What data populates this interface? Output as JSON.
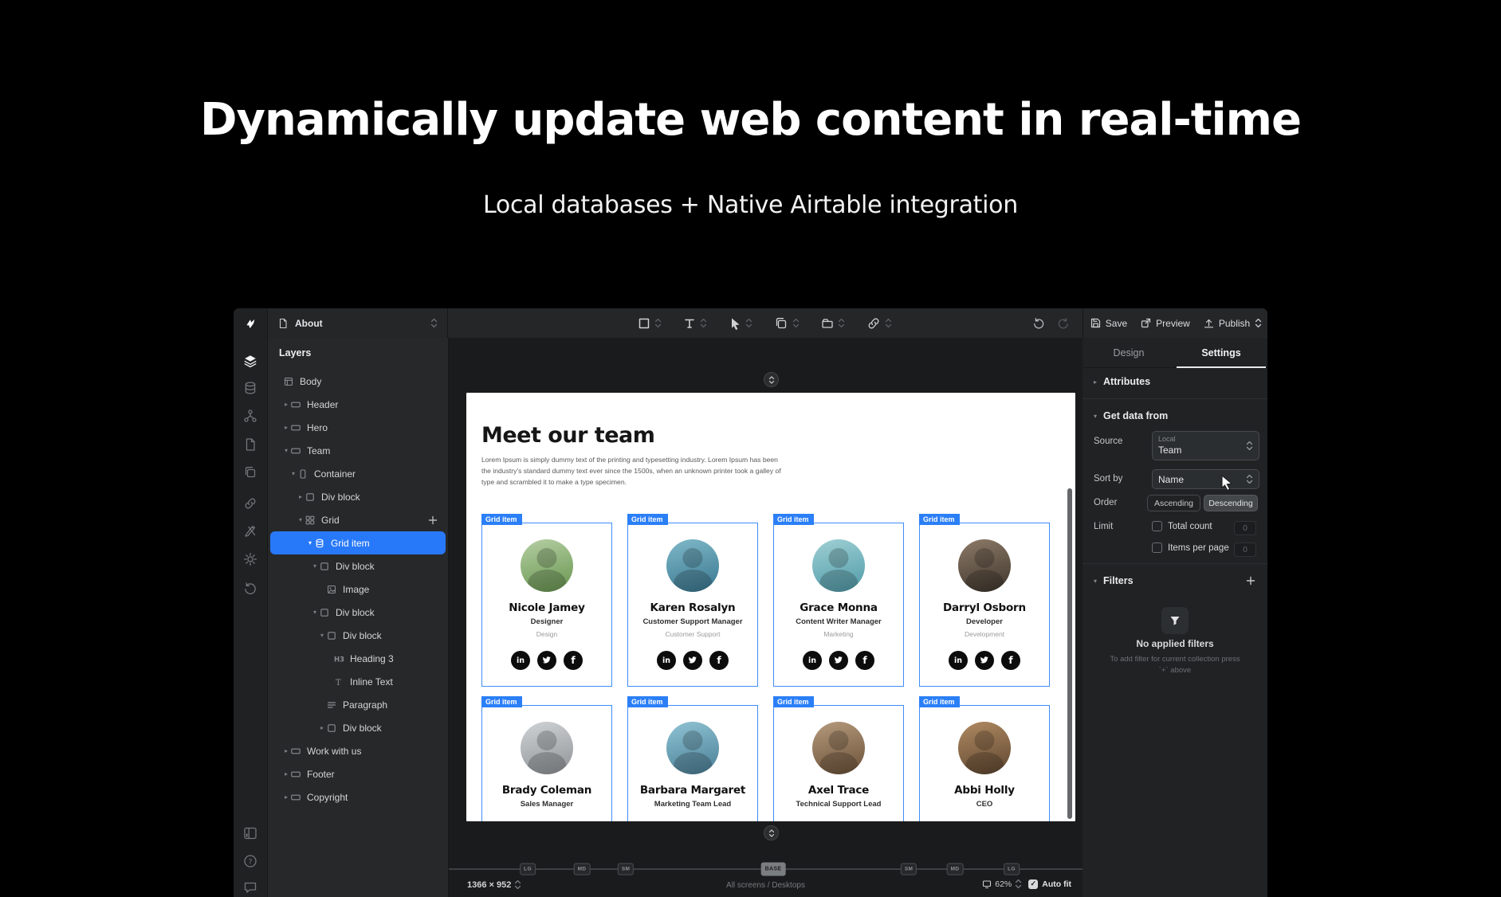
{
  "hero": {
    "title": "Dynamically update web content in real-time",
    "subtitle": "Local databases + Native Airtable integration"
  },
  "app": {
    "topbar": {
      "page_switcher": {
        "icon": "page-icon",
        "label": "About"
      },
      "tools": [
        "rect-tool-icon",
        "text-tool-icon",
        "cursor-tool-icon",
        "copy-tool-icon",
        "folder-tool-icon",
        "link-tool-icon"
      ],
      "history": {
        "undo": "undo-icon",
        "redo": "redo-icon"
      },
      "actions": {
        "save": "Save",
        "preview": "Preview",
        "publish": "Publish"
      }
    },
    "rail": {
      "top": [
        "layers",
        "database",
        "flow",
        "page",
        "copy",
        "link",
        "tools",
        "gear",
        "history"
      ],
      "bottom": [
        "panels",
        "help",
        "chat"
      ]
    },
    "layers_panel": {
      "title": "Layers",
      "tree": [
        {
          "label": "Body",
          "icon": "body",
          "level": 0,
          "caret": "none"
        },
        {
          "label": "Header",
          "icon": "section",
          "level": 1,
          "caret": "closed"
        },
        {
          "label": "Hero",
          "icon": "section",
          "level": 1,
          "caret": "closed"
        },
        {
          "label": "Team",
          "icon": "section",
          "level": 1,
          "caret": "open"
        },
        {
          "label": "Container",
          "icon": "container",
          "level": 2,
          "caret": "open"
        },
        {
          "label": "Div block",
          "icon": "div",
          "level": 3,
          "caret": "closed"
        },
        {
          "label": "Grid",
          "icon": "grid",
          "level": 3,
          "caret": "open",
          "add": true
        },
        {
          "label": "Grid item",
          "icon": "database",
          "level": 4,
          "caret": "open",
          "selected": true
        },
        {
          "label": "Div block",
          "icon": "div",
          "level": 5,
          "caret": "open"
        },
        {
          "label": "Image",
          "icon": "image",
          "level": 6,
          "caret": "none"
        },
        {
          "label": "Div block",
          "icon": "div",
          "level": 5,
          "caret": "open"
        },
        {
          "label": "Div block",
          "icon": "div",
          "level": 6,
          "caret": "open"
        },
        {
          "label": "Heading 3",
          "icon": "h3",
          "level": 7,
          "caret": "none"
        },
        {
          "label": "Inline Text",
          "icon": "text",
          "level": 7,
          "caret": "none"
        },
        {
          "label": "Paragraph",
          "icon": "paragraph",
          "level": 6,
          "caret": "none"
        },
        {
          "label": "Div block",
          "icon": "div",
          "level": 6,
          "caret": "closed"
        },
        {
          "label": "Work with us",
          "icon": "section",
          "level": 1,
          "caret": "closed"
        },
        {
          "label": "Footer",
          "icon": "section",
          "level": 1,
          "caret": "closed"
        },
        {
          "label": "Copyright",
          "icon": "section",
          "level": 1,
          "caret": "closed"
        }
      ]
    },
    "canvas": {
      "page": {
        "heading": "Meet our team",
        "paragraph": "Lorem Ipsum is simply dummy text of the printing and typesetting industry. Lorem Ipsum has been the industry's standard dummy text ever since the 1500s, when an unknown printer took a galley of type and scrambled it to make a type specimen.",
        "grid_tag": "Grid item",
        "socials": [
          "linkedin",
          "twitter",
          "facebook"
        ],
        "cards": [
          {
            "name": "Nicole Jamey",
            "role": "Designer",
            "dept": "Design",
            "avatar": [
              "#b5cfa3",
              "#67954f"
            ]
          },
          {
            "name": "Karen Rosalyn",
            "role": "Customer Support Manager",
            "dept": "Customer Support",
            "avatar": [
              "#7fb9c9",
              "#39768f"
            ]
          },
          {
            "name": "Grace Monna",
            "role": "Content Writer Manager",
            "dept": "Marketing",
            "avatar": [
              "#9fd0d4",
              "#4f9aa8"
            ]
          },
          {
            "name": "Darryl Osborn",
            "role": "Developer",
            "dept": "Development",
            "avatar": [
              "#8d7a68",
              "#3e352c"
            ]
          },
          {
            "name": "Brady Coleman",
            "role": "Sales Manager",
            "dept": "",
            "avatar": [
              "#cfd3d6",
              "#8f9397"
            ]
          },
          {
            "name": "Barbara Margaret",
            "role": "Marketing Team Lead",
            "dept": "",
            "avatar": [
              "#8fc3d4",
              "#4a7e95"
            ]
          },
          {
            "name": "Axel Trace",
            "role": "Technical Support Lead",
            "dept": "",
            "avatar": [
              "#b59a7d",
              "#6b5138"
            ]
          },
          {
            "name": "Abbi Holly",
            "role": "CEO",
            "dept": "",
            "avatar": [
              "#b08a62",
              "#5e4630"
            ]
          }
        ]
      }
    },
    "bottombar": {
      "breakpoints": [
        "LG",
        "MD",
        "SM",
        "BASE",
        "SM",
        "MD",
        "LG"
      ],
      "size": "1366 × 952",
      "screens": "All screens / Desktops",
      "zoom": "62%",
      "autofit": "Auto fit"
    },
    "right_panel": {
      "tabs": {
        "design": "Design",
        "settings": "Settings"
      },
      "attributes_label": "Attributes",
      "get_data": {
        "title": "Get data from",
        "source_label": "Source",
        "source_type": "Local",
        "source_value": "Team",
        "sort_label": "Sort by",
        "sort_value": "Name",
        "order_label": "Order",
        "ascending": "Ascending",
        "descending": "Descending",
        "limit_label": "Limit",
        "total_count_label": "Total count",
        "total_count_value": "0",
        "items_per_page_label": "Items per page",
        "items_per_page_value": "0"
      },
      "filters": {
        "title": "Filters",
        "empty": "No applied filters",
        "hint": "To add filter for current collection press `+` above"
      }
    }
  },
  "colors": {
    "accent_blue": "#2b7ff7",
    "selection_blue": "#2879f9",
    "card_border_blue": "#3f8cf8",
    "app_bg": "#242628",
    "canvas_bg": "#1a1b1d"
  }
}
